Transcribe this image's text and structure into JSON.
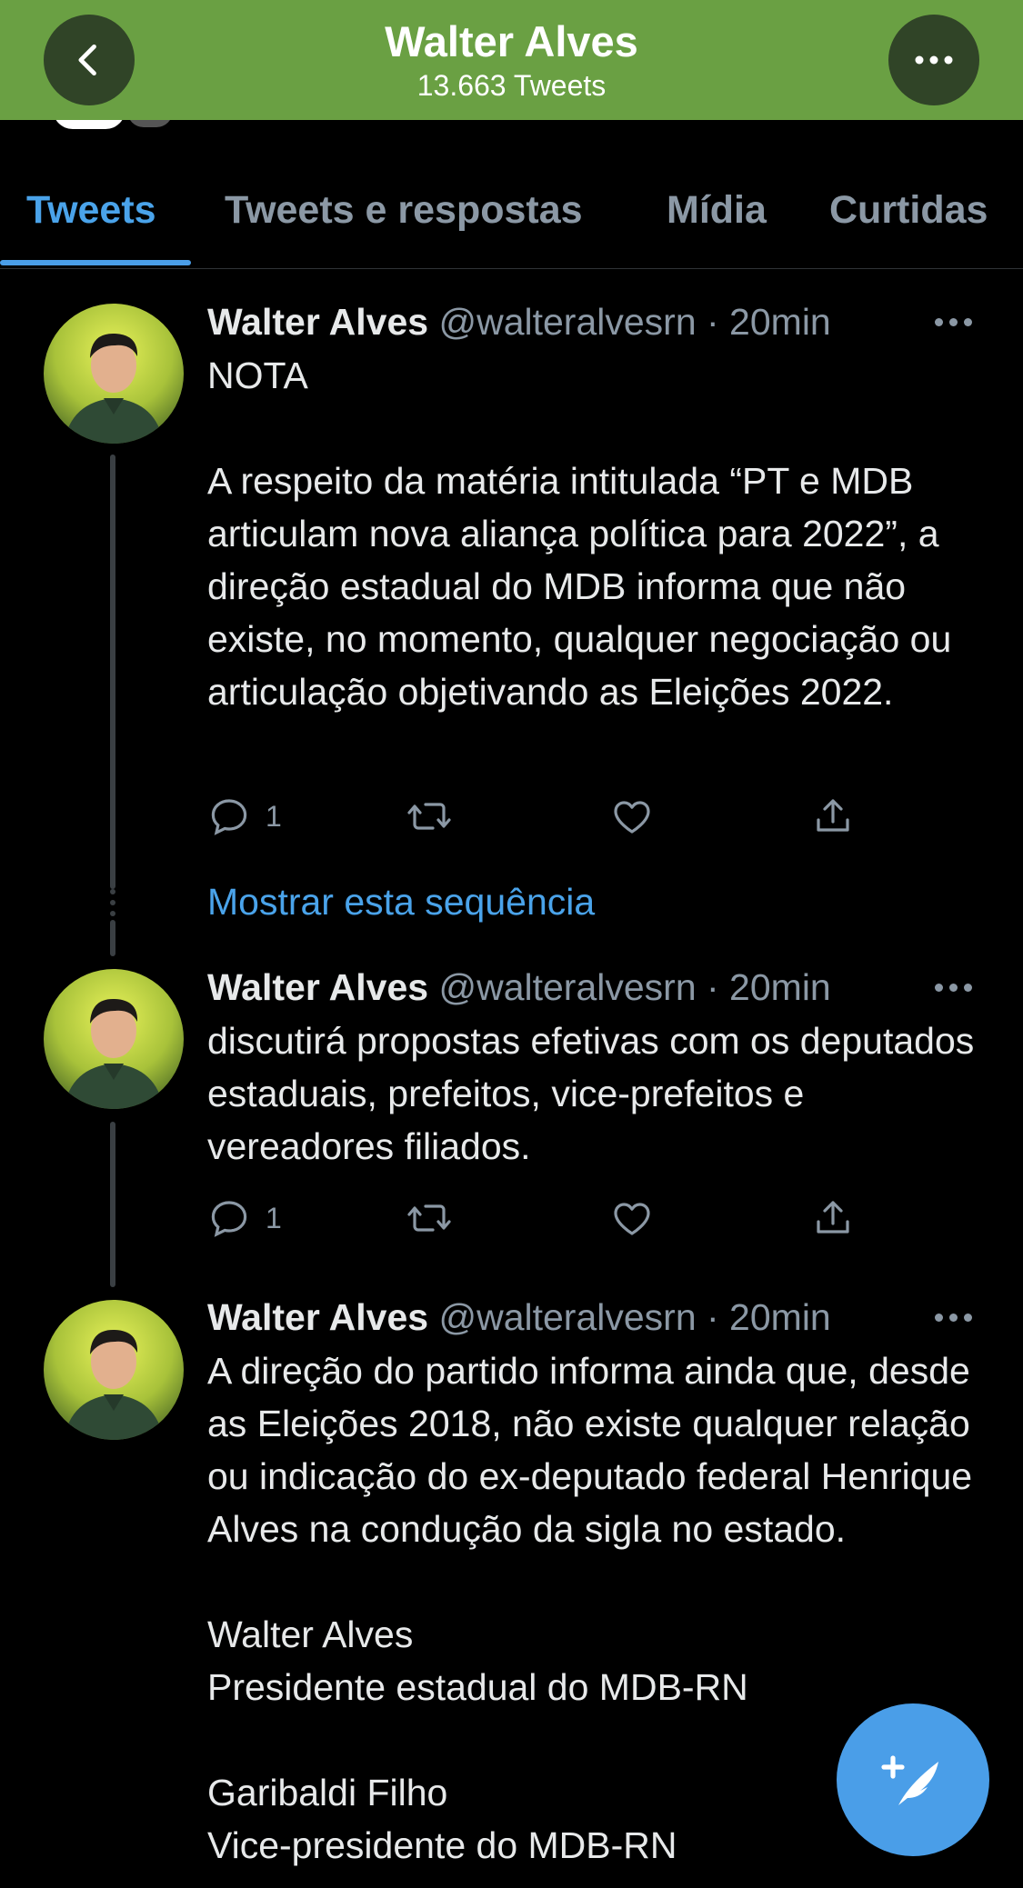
{
  "header": {
    "title": "Walter Alves",
    "subtitle": "13.663 Tweets"
  },
  "tabs": [
    {
      "label": "Tweets",
      "active": true
    },
    {
      "label": "Tweets e respostas",
      "active": false
    },
    {
      "label": "Mídia",
      "active": false
    },
    {
      "label": "Curtidas",
      "active": false
    }
  ],
  "tweets": [
    {
      "name": "Walter Alves",
      "meta": "@walteralvesrn · 20min",
      "text": "NOTA\n\nA respeito da matéria intitulada “PT e MDB articulam nova aliança política para 2022”, a direção estadual do MDB informa que não existe, no momento, qualquer negociação ou articulação objetivando as Eleições 2022.",
      "reply_count": "1",
      "show_thread": "Mostrar esta sequência"
    },
    {
      "name": "Walter Alves",
      "meta": "@walteralvesrn · 20min",
      "text": "discutirá propostas efetivas com os deputados estaduais, prefeitos, vice-prefeitos e vereadores filiados.",
      "reply_count": "1"
    },
    {
      "name": "Walter Alves",
      "meta": "@walteralvesrn · 20min",
      "text": "A direção do partido informa ainda que, desde as Eleições 2018, não existe qualquer relação ou indicação do ex-deputado federal Henrique Alves na condução da sigla no estado.\n\nWalter Alves\nPresidente estadual do MDB-RN\n\nGaribaldi Filho\nVice-presidente do MDB-RN"
    }
  ],
  "colors": {
    "header_bg": "#6aa043",
    "accent": "#4a9ee8",
    "background": "#000000",
    "muted": "#8b98a5"
  },
  "icons": [
    "back-icon",
    "more-icon",
    "reply-icon",
    "retweet-icon",
    "like-icon",
    "share-icon",
    "compose-icon"
  ]
}
